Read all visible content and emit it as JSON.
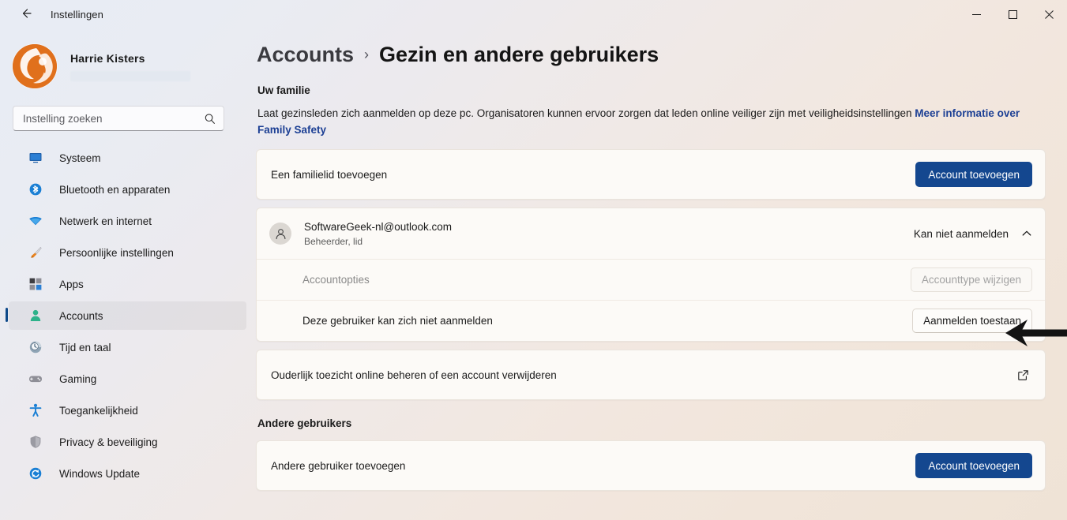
{
  "window": {
    "title": "Instellingen",
    "back_icon": "arrow-left-icon",
    "minimize_label": "—",
    "maximize_label": "□",
    "close_label": "✕"
  },
  "sidebar": {
    "profile": {
      "name": "Harrie Kisters",
      "avatar_icon": "user-avatar-logo",
      "redacted_account": ""
    },
    "search": {
      "placeholder": "Instelling zoeken",
      "value": "",
      "icon": "search-icon"
    },
    "items": [
      {
        "label": "Systeem",
        "icon": "monitor-icon",
        "selected": false
      },
      {
        "label": "Bluetooth en apparaten",
        "icon": "bluetooth-icon",
        "selected": false
      },
      {
        "label": "Netwerk en internet",
        "icon": "wifi-icon",
        "selected": false
      },
      {
        "label": "Persoonlijke instellingen",
        "icon": "paintbrush-icon",
        "selected": false
      },
      {
        "label": "Apps",
        "icon": "apps-icon",
        "selected": false
      },
      {
        "label": "Accounts",
        "icon": "person-icon",
        "selected": true
      },
      {
        "label": "Tijd en taal",
        "icon": "clock-globe-icon",
        "selected": false
      },
      {
        "label": "Gaming",
        "icon": "gamepad-icon",
        "selected": false
      },
      {
        "label": "Toegankelijkheid",
        "icon": "accessibility-icon",
        "selected": false
      },
      {
        "label": "Privacy & beveiliging",
        "icon": "shield-icon",
        "selected": false
      },
      {
        "label": "Windows Update",
        "icon": "refresh-icon",
        "selected": false
      }
    ]
  },
  "main": {
    "breadcrumb": {
      "parent": "Accounts",
      "separator": "›",
      "current": "Gezin en andere gebruikers"
    },
    "family_section": {
      "title": "Uw familie",
      "description": "Laat gezinsleden zich aanmelden op deze pc. Organisatoren kunnen ervoor zorgen dat leden online veiliger zijn met veiligheidsinstellingen",
      "link_text": "Meer informatie over Family Safety",
      "add_member": {
        "label": "Een familielid toevoegen",
        "button": "Account toevoegen"
      },
      "account": {
        "avatar_icon": "person-circle-icon",
        "email": "SoftwareGeek-nl@outlook.com",
        "role": "Beheerder, lid",
        "status": "Kan niet aanmelden",
        "chevron_icon": "chevron-up-icon",
        "options": {
          "label": "Accountopties",
          "button": "Accounttype wijzigen",
          "button_disabled": true
        },
        "signin": {
          "label": "Deze gebruiker kan zich niet aanmelden",
          "button": "Aanmelden toestaan"
        }
      },
      "parental": {
        "label": "Ouderlijk toezicht online beheren of een account verwijderen",
        "icon": "external-link-icon"
      }
    },
    "other_users_section": {
      "title": "Andere gebruikers",
      "add_user": {
        "label": "Andere gebruiker toevoegen",
        "button": "Account toevoegen"
      }
    },
    "annotation": {
      "arrow_icon": "left-arrow-annotation",
      "points_to": "Aanmelden toestaan"
    }
  },
  "colors": {
    "accent": "#14478f",
    "link": "#1c3f94",
    "card_bg": "#fcfaf7",
    "selected_bar": "#0f4a8a"
  }
}
